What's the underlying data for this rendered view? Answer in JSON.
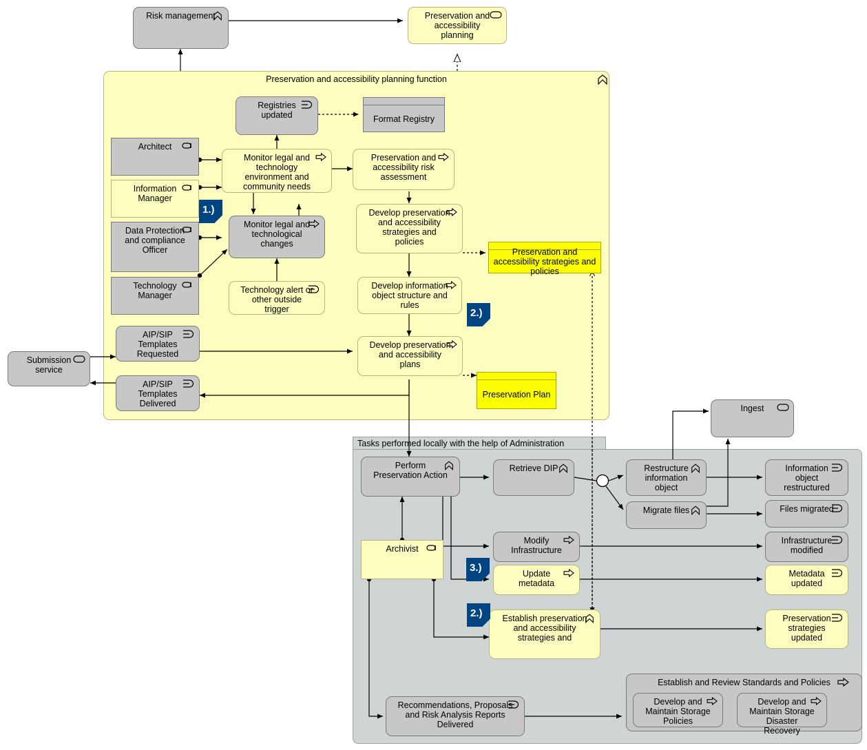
{
  "diagram": {
    "title": "Preservation and accessibility planning",
    "colors": {
      "grey_fill": "#c7c7c7",
      "yellow_fill": "#fdfdc0",
      "strong_yellow_fill": "#fcfc00",
      "group_grey_fill": "#cfd5d5",
      "badge_blue": "#004481",
      "line": "#000000"
    }
  },
  "top": {
    "risk_management": "Risk management",
    "preservation_planning_service": "Preservation and accessibility planning"
  },
  "yellow_group": {
    "title": "Preservation and accessibility planning function"
  },
  "grey_group": {
    "title": "Tasks performed locally with the help of Administration"
  },
  "standards_group": {
    "title": "Establish and Review Standards and Policies",
    "children": [
      "Develop and Maintain Storage Policies",
      "Develop and Maintain Storage Disaster Recovery"
    ]
  },
  "roles": [
    {
      "label": "Architect",
      "fill": "grey"
    },
    {
      "label": "Information Manager",
      "fill": "yellow"
    },
    {
      "label": "Data Protection and compliance Officer",
      "fill": "grey"
    },
    {
      "label": "Technology Manager",
      "fill": "grey"
    },
    {
      "label": "Archivist",
      "fill": "yellow"
    }
  ],
  "nodes": {
    "registries_updated": "Registries updated",
    "format_registry": "Format Registry",
    "monitor_legal_env": "Monitor legal and technology environment and community needs",
    "preservation_risk_assessment": "Preservation and accessibility risk assessment",
    "monitor_legal_changes": "Monitor legal and technological changes",
    "develop_strategies_policies": "Develop preservation and accessibility strategies and policies",
    "technology_alert": "Technology alert or other outside trigger",
    "develop_info_object": "Develop information object structure and rules",
    "strategies_policies_obj": "Preservation and accessibility strategies and policies",
    "develop_plans": "Develop preservation and accessibility plans",
    "preservation_plan_obj": "Preservation Plan",
    "aip_sip_requested": "AIP/SIP Templates Requested",
    "aip_sip_delivered": "AIP/SIP Templates Delivered",
    "submission_service": "Submission service",
    "perform_preservation_action": "Perform Preservation Action",
    "retrieve_dip": "Retrieve DIP",
    "modify_infrastructure": "Modify Infrastructure",
    "update_metadata": "Update metadata",
    "establish_strategies": "Establish preservation and accessibility strategies and",
    "restructure_info_object": "Restructure information object",
    "migrate_files": "Migrate files",
    "ingest": "Ingest",
    "information_object_restructured": "Information object restructured",
    "files_migrated": "Files migrated",
    "infrastructure_modified": "Infrastructure modified",
    "metadata_updated": "Metadata updated",
    "preservation_strategies_updated": "Preservation strategies updated",
    "recommendations_reports": "Recommendations, Proposals and Risk Analysis Reports Delivered",
    "develop_storage_policies": "Develop and Maintain Storage Policies",
    "develop_disaster_recovery": "Develop and Maintain Storage Disaster Recovery"
  },
  "badges": {
    "b1": "1.)",
    "b2a": "2.)",
    "b3": "3.)",
    "b2b": "2.)"
  }
}
